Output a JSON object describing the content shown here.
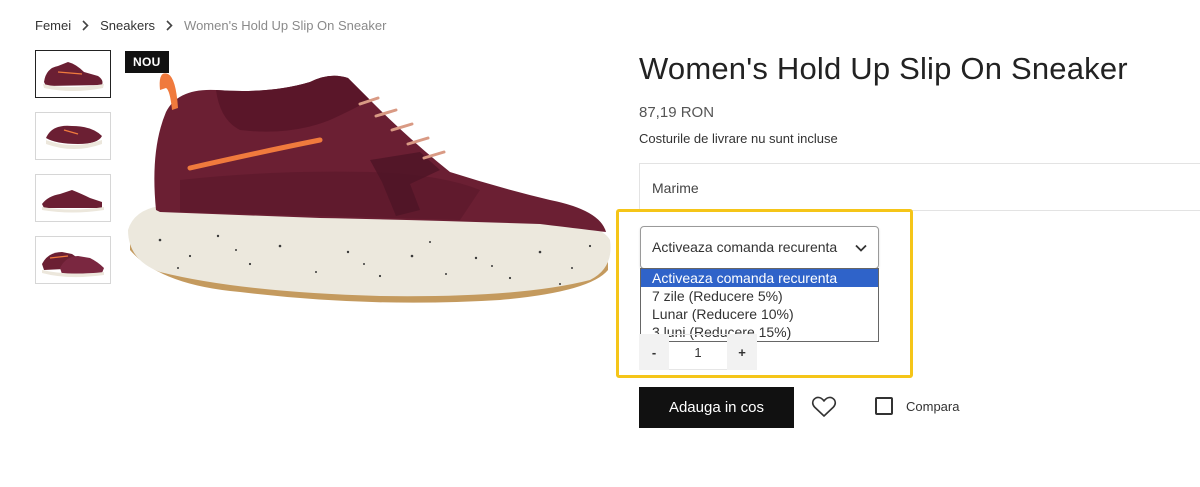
{
  "breadcrumb": {
    "items": [
      "Femei",
      "Sneakers",
      "Women's Hold Up Slip On Sneaker"
    ]
  },
  "badge": "NOU",
  "product": {
    "title": "Women's Hold Up Slip On Sneaker",
    "price": "87,19 RON",
    "shipping_note": "Costurile de livrare nu sunt incluse",
    "size_label": "Marime"
  },
  "recurring": {
    "selected": "Activeaza comanda recurenta",
    "options": [
      "Activeaza comanda recurenta",
      "7 zile (Reducere 5%)",
      "Lunar (Reducere 10%)",
      "3 luni (Reducere 15%)"
    ]
  },
  "quantity": {
    "minus": "-",
    "value": "1",
    "plus": "+"
  },
  "actions": {
    "add_to_cart": "Adauga in cos",
    "compare": "Compara"
  },
  "colors": {
    "shoe_primary": "#6b1f33",
    "shoe_accent": "#f07a3d",
    "highlight": "#f5c518",
    "option_selected": "#2f63c9"
  }
}
